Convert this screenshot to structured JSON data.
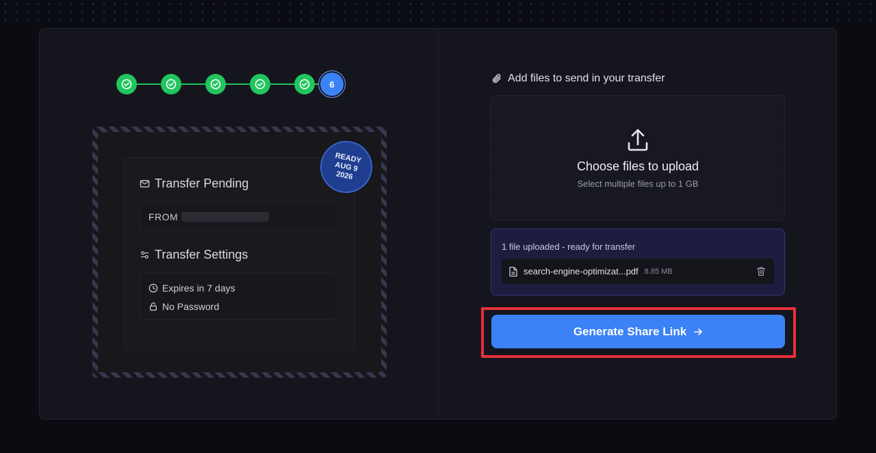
{
  "stepper": {
    "completed_steps": 5,
    "current_step": "6"
  },
  "envelope": {
    "stamp": {
      "line1": "READY",
      "line2": "AUG 9",
      "line3": "2026"
    },
    "pending_title": "Transfer Pending",
    "from_label": "FROM",
    "settings_title": "Transfer Settings",
    "expires": "Expires in 7 days",
    "password": "No Password"
  },
  "upload": {
    "heading": "Add files to send in your transfer",
    "drop_title": "Choose files to upload",
    "drop_subtitle": "Select multiple files up to 1 GB",
    "status": "1 file uploaded - ready for transfer",
    "file": {
      "name": "search-engine-optimizat...pdf",
      "size": "8.85 MB"
    }
  },
  "actions": {
    "generate_label": "Generate Share Link",
    "generate_icon": "arrow-right-icon"
  },
  "colors": {
    "accent": "#3b82f6",
    "success": "#22c55e",
    "highlight": "#e8303b",
    "stamp": "#1f3e8f"
  }
}
